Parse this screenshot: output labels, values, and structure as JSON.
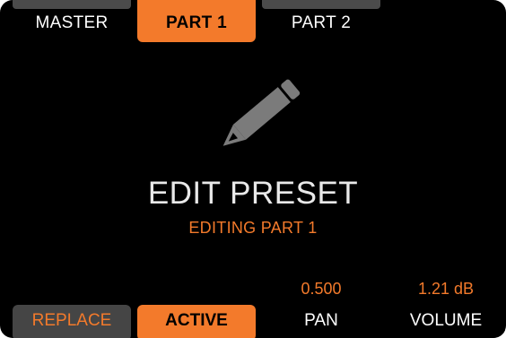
{
  "tabs": [
    {
      "label": "MASTER",
      "active": false
    },
    {
      "label": "PART 1",
      "active": true
    },
    {
      "label": "PART 2",
      "active": false
    }
  ],
  "center": {
    "icon": "pencil-icon",
    "title": "EDIT PRESET",
    "subtitle": "EDITING PART 1"
  },
  "params": {
    "pan_value": "0.500",
    "volume_value": "1.21 dB"
  },
  "bottom_buttons": {
    "replace": "REPLACE",
    "active": "ACTIVE",
    "pan": "PAN",
    "volume": "VOLUME"
  },
  "colors": {
    "accent": "#f37a2b",
    "background": "#000000",
    "inactive_button": "#454545",
    "text": "#ffffff"
  }
}
